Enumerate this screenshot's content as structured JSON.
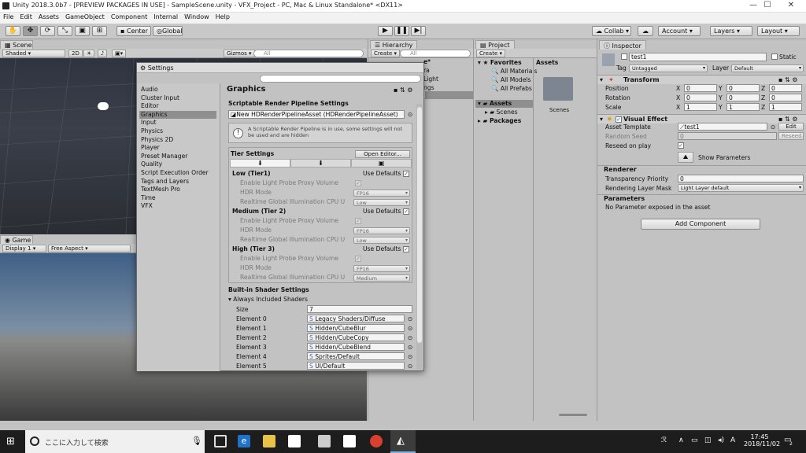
{
  "window": {
    "title": "Unity 2018.3.0b7 - [PREVIEW PACKAGES IN USE] - SampleScene.unity - VFX_Project - PC, Mac & Linux Standalone* <DX11>",
    "controls": [
      "—",
      "☐",
      "✕"
    ]
  },
  "menu": [
    "File",
    "Edit",
    "Assets",
    "GameObject",
    "Component",
    "Internal",
    "Window",
    "Help"
  ],
  "toolbar": {
    "center": "Center",
    "global": "Global",
    "collab": "Collab ▾",
    "account": "Account",
    "layers": "Layers",
    "layout": "Layout"
  },
  "scene": {
    "tab": "Scene",
    "shading": "Shaded",
    "mode2d": "2D",
    "gizmos": "Gizmos ▾",
    "search": "All"
  },
  "game": {
    "tab": "Game",
    "display": "Display 1",
    "aspect": "Free Aspect"
  },
  "hierarchy": {
    "tab": "Hierarchy",
    "create": "Create ▾",
    "search": "All",
    "items": [
      "e*",
      "ra",
      "Light",
      "ngs"
    ]
  },
  "project": {
    "tab": "Project",
    "create": "Create ▾",
    "favorites": "Favorites",
    "fav_items": [
      "All Materials",
      "All Models",
      "All Prefabs"
    ],
    "tree": [
      "Assets",
      "Scenes",
      "Packages"
    ],
    "assets_header": "Assets",
    "folder": "Scenes"
  },
  "settings": {
    "title": "Settings",
    "categories": [
      "Audio",
      "Cluster Input",
      "Editor",
      "Graphics",
      "Input",
      "Physics",
      "Physics 2D",
      "Player",
      "Preset Manager",
      "Quality",
      "Script Execution Order",
      "Tags and Layers",
      "TextMesh Pro",
      "Time",
      "VFX"
    ],
    "heading": "Graphics",
    "srp_label": "Scriptable Render Pipeline Settings",
    "srp_value": "New HDRenderPipelineAsset (HDRenderPipelineAsset)",
    "info": "A Scriptable Render Pipeline is in use, some settings will not be used and are hidden",
    "tier_settings": "Tier Settings",
    "open_editor": "Open Editor...",
    "tiers": [
      {
        "name": "Low (Tier1)",
        "quality": "Low"
      },
      {
        "name": "Medium (Tier 2)",
        "quality": "Low"
      },
      {
        "name": "High (Tier 3)",
        "quality": "Medium"
      }
    ],
    "use_defaults": "Use Defaults",
    "opt_probe": "Enable Light Probe Proxy Volume",
    "opt_hdr": "HDR Mode",
    "opt_rgi": "Realtime Global Illumination CPU U",
    "hdr_value": "FP16",
    "builtin": "Built-in Shader Settings",
    "always": "Always Included Shaders",
    "size_label": "Size",
    "size_value": "7",
    "elements": [
      {
        "label": "Element 0",
        "value": "Legacy Shaders/Diffuse"
      },
      {
        "label": "Element 1",
        "value": "Hidden/CubeBlur"
      },
      {
        "label": "Element 2",
        "value": "Hidden/CubeCopy"
      },
      {
        "label": "Element 3",
        "value": "Hidden/CubeBlend"
      },
      {
        "label": "Element 4",
        "value": "Sprites/Default"
      },
      {
        "label": "Element 5",
        "value": "UI/Default"
      }
    ]
  },
  "inspector": {
    "tab": "Inspector",
    "name": "test1",
    "static": "Static",
    "tag_label": "Tag",
    "tag": "Untagged",
    "layer_label": "Layer",
    "layer": "Default",
    "transform": "Transform",
    "rows": [
      {
        "label": "Position",
        "x": "0",
        "y": "0",
        "z": "0"
      },
      {
        "label": "Rotation",
        "x": "0",
        "y": "0",
        "z": "0"
      },
      {
        "label": "Scale",
        "x": "1",
        "y": "1",
        "z": "1"
      }
    ],
    "vfx": "Visual Effect",
    "asset_template": "Asset Template",
    "template_value": "test1",
    "edit": "Edit",
    "random_seed": "Random Seed",
    "seed_value": "0",
    "reseed": "Reseed",
    "reseed_play": "Reseed on play",
    "show_params": "Show Parameters",
    "renderer": "Renderer",
    "transparency": "Transparency Priority",
    "transparency_value": "0",
    "render_mask": "Rendering Layer Mask",
    "render_mask_value": "Light Layer default",
    "parameters": "Parameters",
    "no_param": "No Parameter exposed in the asset",
    "add_component": "Add Component"
  },
  "taskbar": {
    "search": "ここに入力して検索",
    "time": "17:45",
    "date": "2018/11/02",
    "ime": "A",
    "notif": "2"
  }
}
